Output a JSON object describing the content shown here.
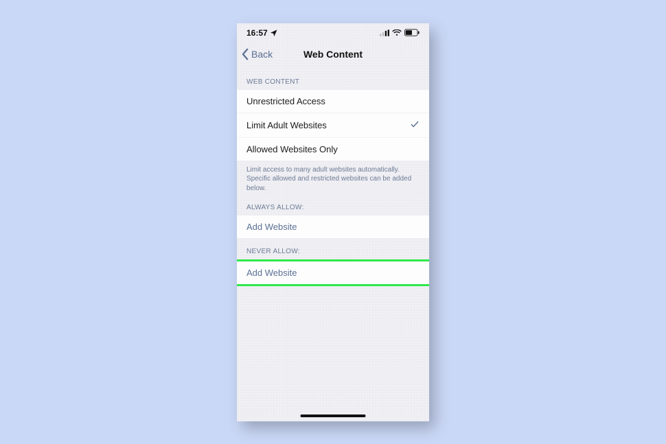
{
  "status": {
    "time": "16:57"
  },
  "nav": {
    "back": "Back",
    "title": "Web Content"
  },
  "sections": {
    "webcontent": {
      "header": "WEB CONTENT",
      "options": [
        {
          "label": "Unrestricted Access",
          "selected": false
        },
        {
          "label": "Limit Adult Websites",
          "selected": true
        },
        {
          "label": "Allowed Websites Only",
          "selected": false
        }
      ],
      "footer": "Limit access to many adult websites automatically. Specific allowed and restricted websites can be added below."
    },
    "always_allow": {
      "header": "ALWAYS ALLOW:",
      "add": "Add Website"
    },
    "never_allow": {
      "header": "NEVER ALLOW:",
      "add": "Add Website"
    }
  }
}
